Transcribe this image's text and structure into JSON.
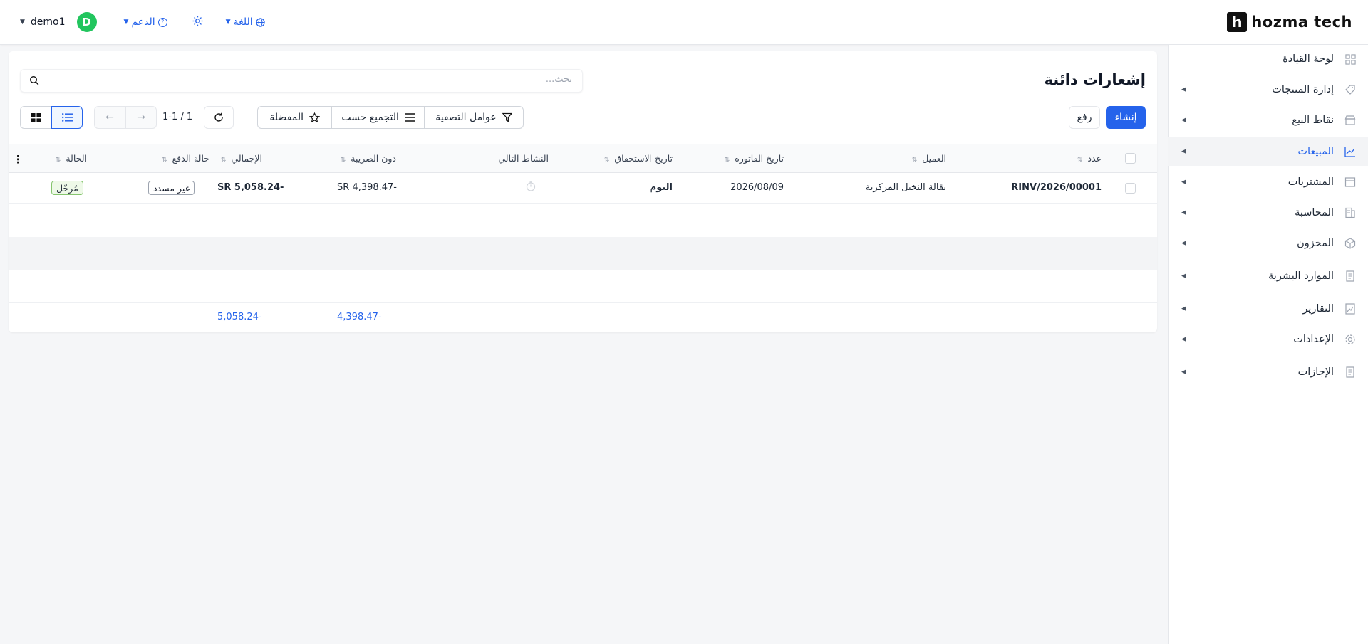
{
  "brand": {
    "logo_letter": "h",
    "name": "hozma tech"
  },
  "topbar": {
    "username": "demo1",
    "avatar_letter": "D",
    "support_label": "الدعم",
    "language_label": "اللغة",
    "theme_icon": "sun-icon"
  },
  "sidebar": {
    "items": [
      {
        "label": "لوحة القيادة",
        "icon": "dashboard-icon"
      },
      {
        "label": "إدارة المنتجات",
        "icon": "tag-icon"
      },
      {
        "label": "نقاط البيع",
        "icon": "store-icon"
      },
      {
        "label": "المبيعات",
        "icon": "chart-line-icon"
      },
      {
        "label": "المشتريات",
        "icon": "box-icon"
      },
      {
        "label": "المحاسبة",
        "icon": "ledger-icon"
      },
      {
        "label": "المخزون",
        "icon": "cube-icon"
      },
      {
        "label": "الموارد البشرية",
        "icon": "document-icon"
      },
      {
        "label": "التقارير",
        "icon": "report-icon"
      },
      {
        "label": "الإعدادات",
        "icon": "gear-icon"
      },
      {
        "label": "الإجازات",
        "icon": "document-icon"
      }
    ]
  },
  "page": {
    "title": "إشعارات دائنة",
    "search_placeholder": "بحث..."
  },
  "toolbar": {
    "create_label": "إنشاء",
    "upload_label": "رفع",
    "filters_label": "عوامل التصفية",
    "groupby_label": "التجميع حسب",
    "favorites_label": "المفضلة",
    "pager_text": "1-1 / 1"
  },
  "table": {
    "columns": {
      "number": "عدد",
      "customer": "العميل",
      "invoice_date": "تاريخ الفاتورة",
      "due_date": "تاريخ الاستحقاق",
      "next_activity": "النشاط التالي",
      "untaxed": "دون الضريبة",
      "total": "الإجمالي",
      "payment_state": "حالة الدفع",
      "status": "الحالة"
    },
    "rows": [
      {
        "number": "RINV/2026/00001",
        "customer": "بقالة النخيل المركزية",
        "invoice_date": "2026/08/09",
        "due_date": "اليوم",
        "untaxed": "SR 4,398.47-",
        "total": "SR 5,058.24-",
        "payment_state": "غير مسدد",
        "status": "مُرحّل"
      }
    ],
    "totals": {
      "untaxed": "4,398.47-",
      "total": "5,058.24-"
    }
  },
  "colors": {
    "accent": "#2563eb",
    "avatar": "#22c55e",
    "posted_badge": "#eef9e8"
  }
}
